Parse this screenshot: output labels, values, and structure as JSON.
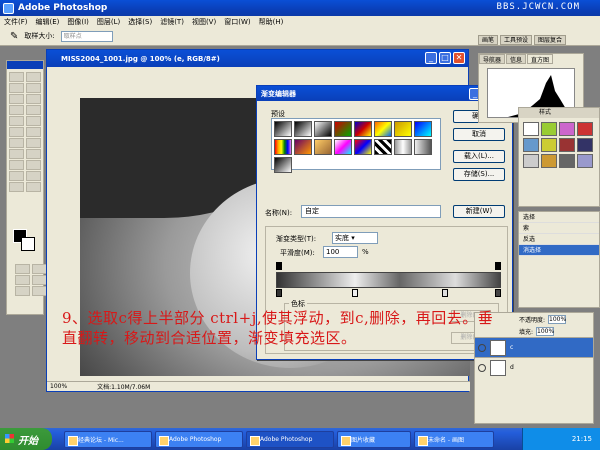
{
  "window": {
    "title": "Adobe Photoshop",
    "watermark": "BBS.JCWCN.COM"
  },
  "menu": [
    "文件(F)",
    "编辑(E)",
    "图像(I)",
    "图层(L)",
    "选择(S)",
    "滤镜(T)",
    "视图(V)",
    "窗口(W)",
    "帮助(H)"
  ],
  "options": {
    "sample_label": "取样大小:",
    "sample_value": "取样点",
    "tabs": [
      "画笔",
      "工具预设",
      "图层复合"
    ]
  },
  "document": {
    "title": "MISS2004_1001.jpg @ 100% (e, RGB/8#)",
    "zoom": "100%",
    "docsize": "文档:1.10M/7.06M"
  },
  "gradient_editor": {
    "title": "渐变编辑器",
    "presets_label": "预设",
    "buttons": {
      "ok": "确定",
      "cancel": "取消",
      "load": "载入(L)...",
      "save": "存储(S)...",
      "new": "新建(W)"
    },
    "name_label": "名称(N):",
    "name_value": "自定",
    "type_label": "渐变类型(T):",
    "type_value": "实底",
    "smooth_label": "平滑度(M):",
    "smooth_value": "100",
    "percent": "%",
    "stops_label": "色标",
    "delete1": "删除(D)",
    "delete2": "删除(D)"
  },
  "histogram": {
    "tabs": [
      "导航器",
      "信息",
      "直方图"
    ]
  },
  "styles": {
    "title": "样式"
  },
  "history": {
    "items": [
      "选择",
      "索",
      "反选",
      "消选择"
    ]
  },
  "layers": {
    "opacity_label": "不透明度:",
    "opacity_value": "100%",
    "fill_label": "填充:",
    "fill_value": "100%",
    "layers": [
      "c",
      "d"
    ]
  },
  "caption": "9、选取c得上半部分 ctrl+j,使其浮动，到c,删除，再回去。垂直翻转，移动到合适位置，渐变填充选区。",
  "taskbar": {
    "start": "开始",
    "tasks": [
      "经典论坛 - Mic...",
      "Adobe Photoshop",
      "Adobe Photoshop",
      "图片收藏",
      "未命名 - 画图"
    ],
    "clock": "21:15"
  },
  "colors": {
    "caption": "#d81818",
    "titlebar": "#0a3fb8"
  }
}
